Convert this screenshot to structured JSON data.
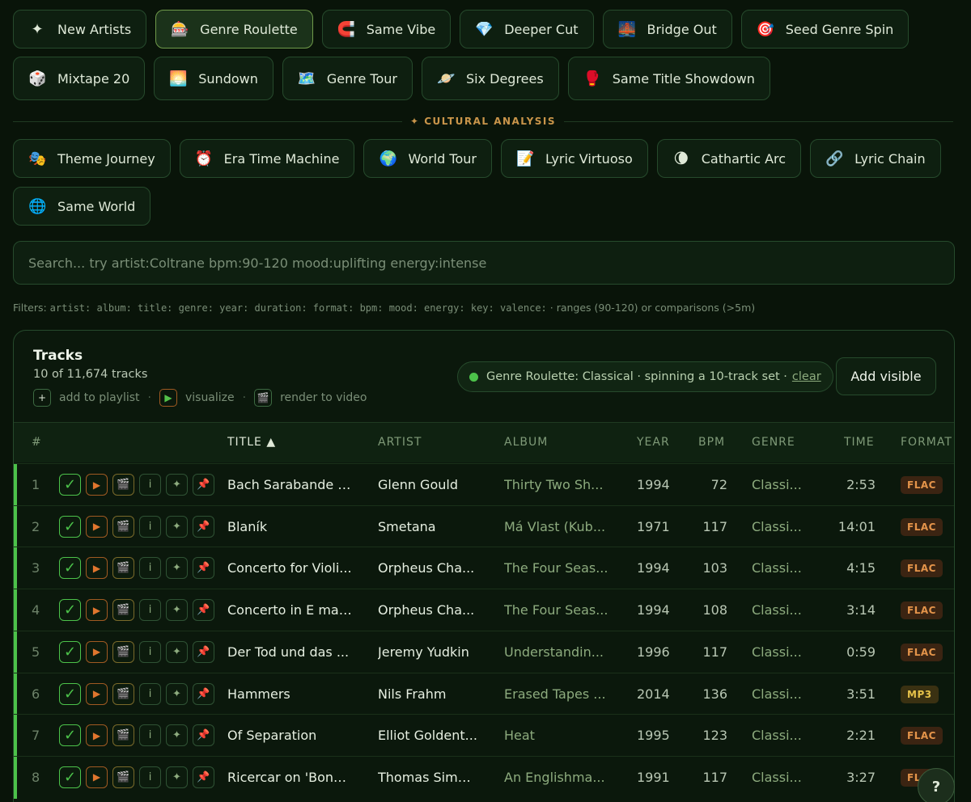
{
  "discovery_modes": [
    {
      "icon": "✦",
      "icon_name": "sparkle-icon",
      "label": "New Artists",
      "active": false
    },
    {
      "icon": "🎰",
      "icon_name": "slot-machine-icon",
      "label": "Genre Roulette",
      "active": true
    },
    {
      "icon": "🧲",
      "icon_name": "magnet-icon",
      "label": "Same Vibe",
      "active": false
    },
    {
      "icon": "💎",
      "icon_name": "gem-icon",
      "label": "Deeper Cut",
      "active": false
    },
    {
      "icon": "🌉",
      "icon_name": "bridge-icon",
      "label": "Bridge Out",
      "active": false
    },
    {
      "icon": "🎯",
      "icon_name": "target-icon",
      "label": "Seed Genre Spin",
      "active": false
    },
    {
      "icon": "🎲",
      "icon_name": "dice-icon",
      "label": "Mixtape 20",
      "active": false
    },
    {
      "icon": "🌅",
      "icon_name": "sunset-icon",
      "label": "Sundown",
      "active": false
    },
    {
      "icon": "🗺️",
      "icon_name": "map-icon",
      "label": "Genre Tour",
      "active": false
    },
    {
      "icon": "🪐",
      "icon_name": "planet-icon",
      "label": "Six Degrees",
      "active": false
    },
    {
      "icon": "🥊",
      "icon_name": "boxing-glove-icon",
      "label": "Same Title Showdown",
      "active": false
    }
  ],
  "section_divider": "✦ CULTURAL ANALYSIS",
  "cultural_modes": [
    {
      "icon": "🎭",
      "icon_name": "theater-masks-icon",
      "label": "Theme Journey"
    },
    {
      "icon": "⏰",
      "icon_name": "alarm-clock-icon",
      "label": "Era Time Machine"
    },
    {
      "icon": "🌍",
      "icon_name": "globe-icon",
      "label": "World Tour"
    },
    {
      "icon": "📝",
      "icon_name": "memo-icon",
      "label": "Lyric Virtuoso"
    },
    {
      "icon": "🌘",
      "icon_name": "moon-icon",
      "label": "Cathartic Arc"
    },
    {
      "icon": "🔗",
      "icon_name": "link-icon",
      "label": "Lyric Chain"
    },
    {
      "icon": "🌐",
      "icon_name": "globe-meridians-icon",
      "label": "Same World"
    }
  ],
  "search": {
    "placeholder": "Search... try artist:Coltrane bpm:90-120 mood:uplifting energy:intense",
    "value": ""
  },
  "filters": {
    "prefix": "Filters:",
    "keys": "artist: album: title: genre: year: duration: format: bpm: mood: energy: key: valence:",
    "suffix": "· ranges (90-120) or comparisons (>5m)"
  },
  "tracks_panel": {
    "title": "Tracks",
    "count_text": "10 of 11,674 tracks",
    "legend": [
      {
        "icon": "+",
        "label": "add to playlist"
      },
      {
        "icon": "▶",
        "label": "visualize"
      },
      {
        "icon": "🎬",
        "label": "render to video"
      }
    ],
    "status_text": "Genre Roulette: Classical · spinning a 10-track set ·",
    "clear_label": "clear",
    "add_visible_label": "Add visible"
  },
  "columns": [
    "#",
    "TITLE ▲",
    "ARTIST",
    "ALBUM",
    "YEAR",
    "BPM",
    "GENRE",
    "TIME",
    "FORMAT"
  ],
  "row_actions": {
    "check": "✓",
    "play": "▶",
    "film": "🎬",
    "info": "i",
    "spark": "✦",
    "pin": "📌"
  },
  "tracks": [
    {
      "num": "1",
      "title": "Bach Sarabande f...",
      "artist": "Glenn Gould",
      "album": "Thirty Two Sh...",
      "year": "1994",
      "bpm": "72",
      "genre": "Classi...",
      "time": "2:53",
      "format": "FLAC"
    },
    {
      "num": "2",
      "title": "Blaník",
      "artist": "Smetana",
      "album": "Má Vlast (Kub...",
      "year": "1971",
      "bpm": "117",
      "genre": "Classi...",
      "time": "14:01",
      "format": "FLAC"
    },
    {
      "num": "3",
      "title": "Concerto for Violi...",
      "artist": "Orpheus Cha...",
      "album": "The Four Seas...",
      "year": "1994",
      "bpm": "103",
      "genre": "Classi...",
      "time": "4:15",
      "format": "FLAC"
    },
    {
      "num": "4",
      "title": "Concerto in E maj...",
      "artist": "Orpheus Cha...",
      "album": "The Four Seas...",
      "year": "1994",
      "bpm": "108",
      "genre": "Classi...",
      "time": "3:14",
      "format": "FLAC"
    },
    {
      "num": "5",
      "title": "Der Tod und das ...",
      "artist": "Jeremy Yudkin",
      "album": "Understandin...",
      "year": "1996",
      "bpm": "117",
      "genre": "Classi...",
      "time": "0:59",
      "format": "FLAC"
    },
    {
      "num": "6",
      "title": "Hammers",
      "artist": "Nils Frahm",
      "album": "Erased Tapes ...",
      "year": "2014",
      "bpm": "136",
      "genre": "Classi...",
      "time": "3:51",
      "format": "MP3"
    },
    {
      "num": "7",
      "title": "Of Separation",
      "artist": "Elliot Goldent...",
      "album": "Heat",
      "year": "1995",
      "bpm": "123",
      "genre": "Classi...",
      "time": "2:21",
      "format": "FLAC"
    },
    {
      "num": "8",
      "title": "Ricercar on 'Bonn...",
      "artist": "Thomas Simp...",
      "album": "An Englishma...",
      "year": "1991",
      "bpm": "117",
      "genre": "Classi...",
      "time": "3:27",
      "format": "FLAC"
    }
  ],
  "help_label": "?",
  "colors": {
    "accent_green": "#4cc24a",
    "accent_orange": "#e4944a",
    "background": "#091409"
  }
}
